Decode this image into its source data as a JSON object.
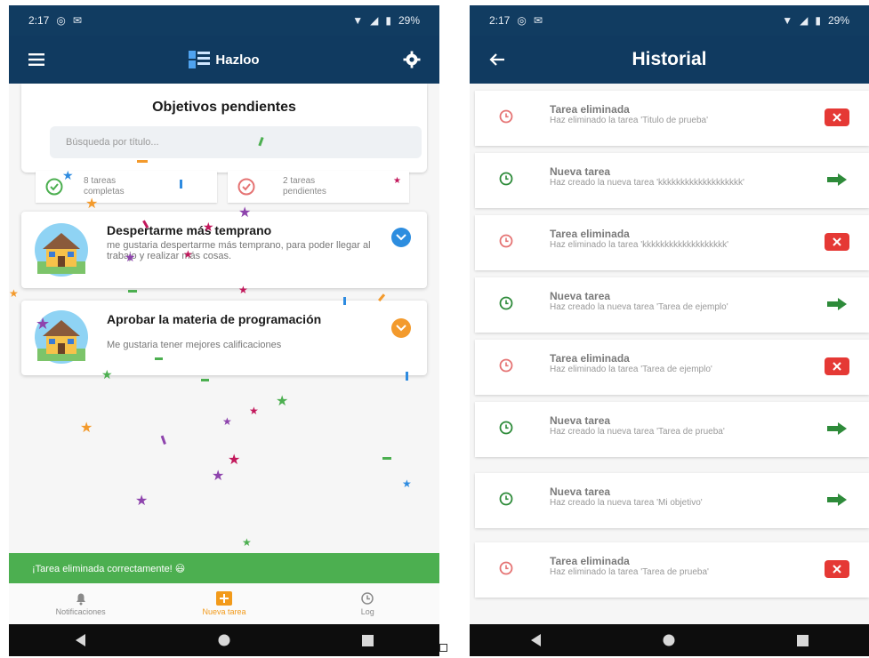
{
  "left": {
    "status": {
      "time": "2:17",
      "battery": "29%"
    },
    "appbar": {
      "brand": "Hazloo"
    },
    "header": {
      "title": "Objetivos pendientes",
      "search_placeholder": "Búsqueda por título..."
    },
    "stats": {
      "completed": "8 tareas completas",
      "pending": "2 tareas pendientes"
    },
    "goals": [
      {
        "title": "Despertarme más temprano",
        "description": "me gustaria despertarme más temprano, para poder llegar al trabajo y realizar más cosas."
      },
      {
        "title": "Aprobar la materia de programación",
        "description": "Me gustaria tener mejores calificaciones"
      }
    ],
    "snackbar": "¡Tarea eliminada correctamente! 😃",
    "bottom_nav": [
      {
        "label": "Notificaciones",
        "icon": "bell-icon",
        "active": false
      },
      {
        "label": "Nueva tarea",
        "icon": "add-icon",
        "active": true
      },
      {
        "label": "Log",
        "icon": "history-icon",
        "active": false
      }
    ]
  },
  "right": {
    "status": {
      "time": "2:17",
      "battery": "29%"
    },
    "appbar": {
      "title": "Historial"
    },
    "items": [
      {
        "type": "deleted",
        "title": "Tarea eliminada",
        "description": "Haz eliminado la tarea 'Titulo de prueba'"
      },
      {
        "type": "created",
        "title": "Nueva tarea",
        "description": "Haz creado la nueva tarea 'kkkkkkkkkkkkkkkkkkk'"
      },
      {
        "type": "deleted",
        "title": "Tarea eliminada",
        "description": "Haz eliminado la tarea 'kkkkkkkkkkkkkkkkkkk'"
      },
      {
        "type": "created",
        "title": "Nueva tarea",
        "description": "Haz creado la nueva tarea 'Tarea de ejemplo'"
      },
      {
        "type": "deleted",
        "title": "Tarea eliminada",
        "description": "Haz eliminado la tarea 'Tarea de ejemplo'"
      },
      {
        "type": "created",
        "title": "Nueva tarea",
        "description": "Haz creado la nueva tarea 'Tarea de prueba'"
      },
      {
        "type": "created",
        "title": "Nueva tarea",
        "description": "Haz creado la nueva tarea 'Mi objetivo'"
      },
      {
        "type": "deleted",
        "title": "Tarea eliminada",
        "description": "Haz eliminado la tarea 'Tarea de prueba'"
      }
    ]
  },
  "colors": {
    "appbar": "#103a60",
    "snackbar": "#4caf50",
    "delete": "#e53935",
    "created": "#2e8b3a",
    "accent": "#f29a1a"
  }
}
